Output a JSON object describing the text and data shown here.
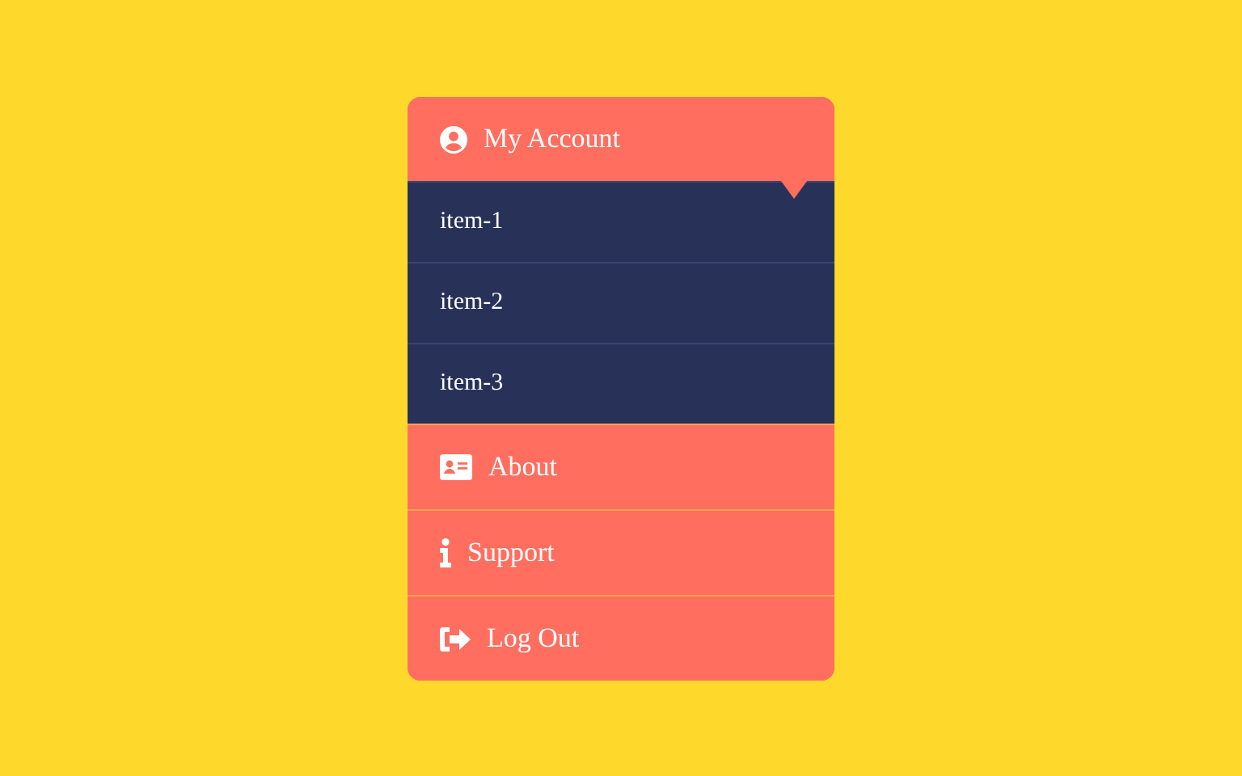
{
  "menu": [
    {
      "label": "My Account",
      "kind": "account",
      "expanded": true,
      "children": [
        "item-1",
        "item-2",
        "item-3"
      ]
    },
    {
      "label": "About",
      "kind": "card",
      "expanded": false
    },
    {
      "label": "Support",
      "kind": "info",
      "expanded": false
    },
    {
      "label": "Log Out",
      "kind": "logout",
      "expanded": false
    }
  ]
}
